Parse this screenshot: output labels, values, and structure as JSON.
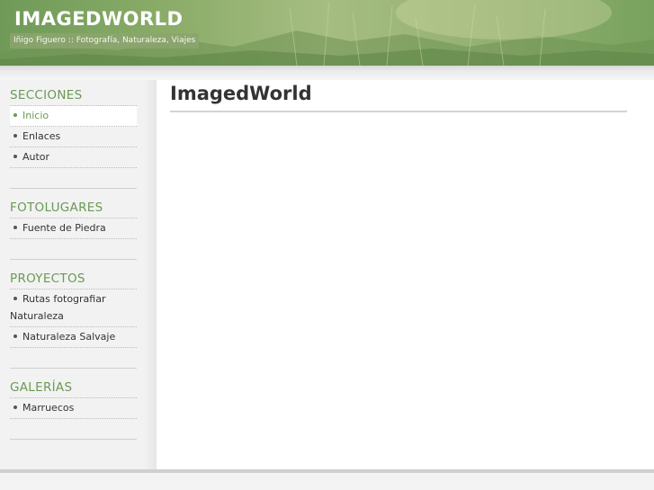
{
  "header": {
    "site_title": "IMAGEDWORLD",
    "tagline": "Iñigo Figuero :: Fotografía, Naturaleza, Viajes"
  },
  "sidebar": {
    "sections": [
      {
        "title": "SECCIONES",
        "items": [
          {
            "label": "Inicio",
            "active": true
          },
          {
            "label": "Enlaces",
            "active": false
          },
          {
            "label": "Autor",
            "active": false
          }
        ]
      },
      {
        "title": "FOTOLUGARES",
        "items": [
          {
            "label": "Fuente de Piedra",
            "active": false
          }
        ]
      },
      {
        "title": "PROYECTOS",
        "items": [
          {
            "label": "Rutas fotografiar Naturaleza",
            "line1": "Rutas fotografiar",
            "line2": "Naturaleza",
            "active": false
          },
          {
            "label": "Naturaleza Salvaje",
            "active": false
          }
        ]
      },
      {
        "title": "GALERÍAS",
        "items": [
          {
            "label": "Marruecos",
            "active": false
          }
        ]
      }
    ]
  },
  "main": {
    "title": "ImagedWorld"
  },
  "colors": {
    "accent": "#6a9a55",
    "header_green": "#8aac68",
    "text": "#333333"
  }
}
